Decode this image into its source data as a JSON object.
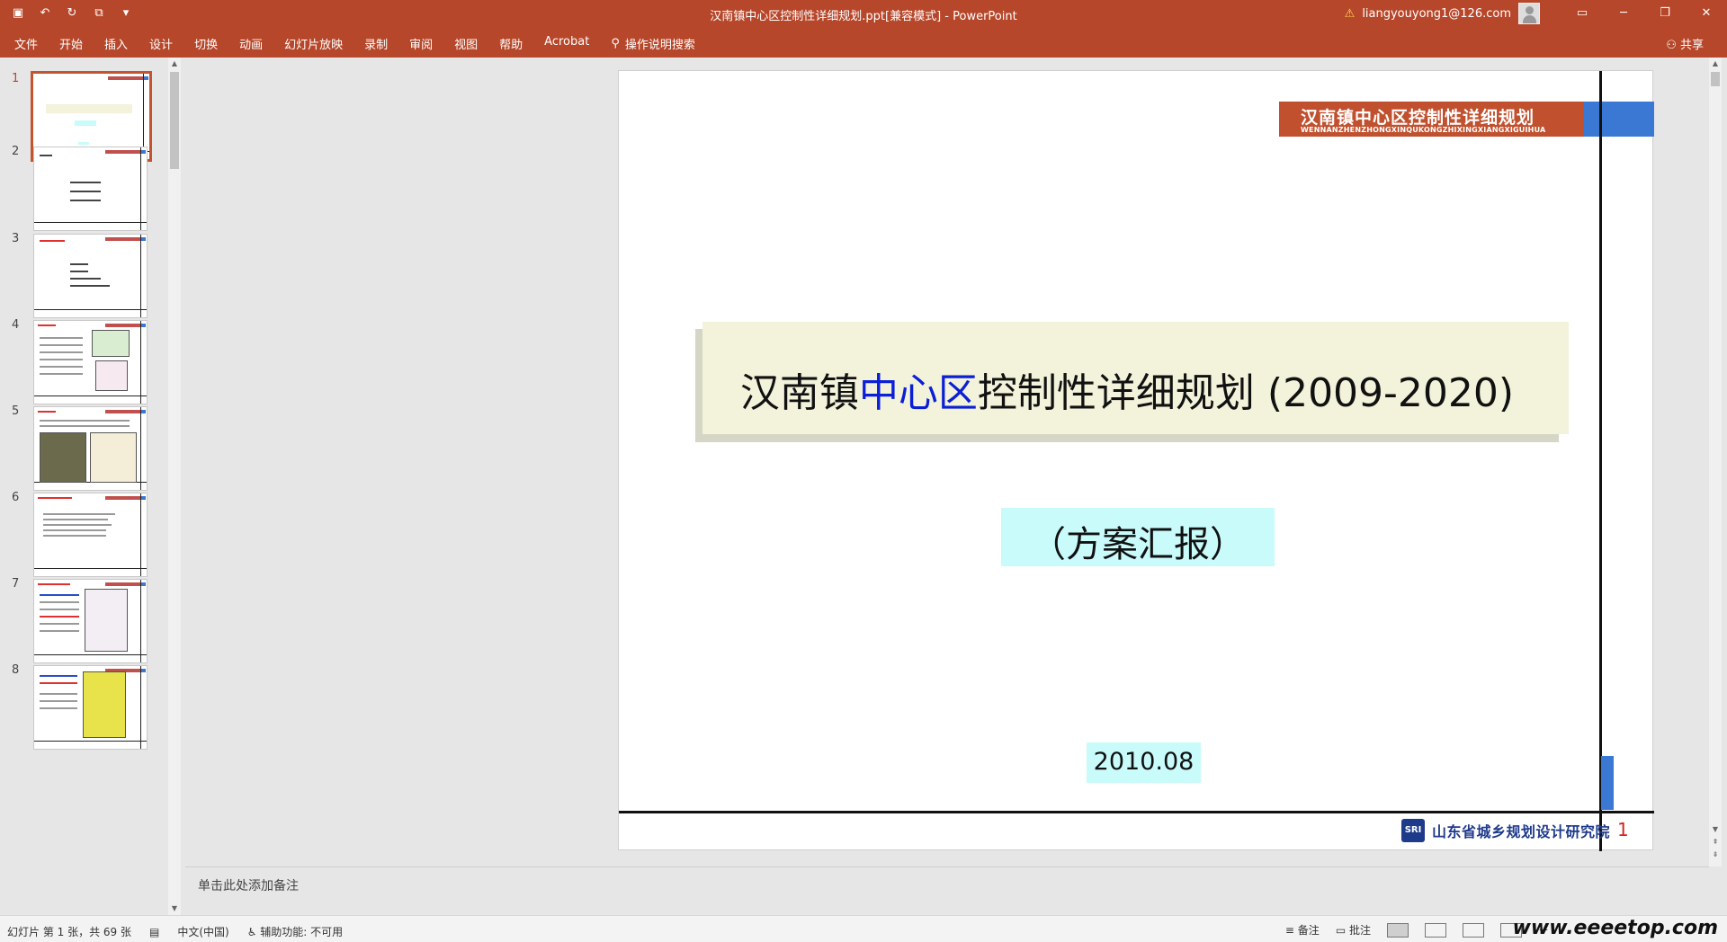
{
  "window": {
    "title": "汉南镇中心区控制性详细规划.ppt[兼容模式]  -  PowerPoint",
    "user_email": "liangyouyong1@126.com",
    "qa_icons": [
      "save-icon",
      "undo-icon",
      "redo-icon",
      "start-from-beginning-icon",
      "customize-icon"
    ],
    "controls": {
      "ribbon_display": "▭",
      "minimize": "─",
      "restore": "❐",
      "close": "✕"
    }
  },
  "ribbon": {
    "tabs": [
      "文件",
      "开始",
      "插入",
      "设计",
      "切换",
      "动画",
      "幻灯片放映",
      "录制",
      "审阅",
      "视图",
      "帮助",
      "Acrobat"
    ],
    "tell_me": "操作说明搜索",
    "share": "共享"
  },
  "thumbnails": [
    "1",
    "2",
    "3",
    "4",
    "5",
    "6",
    "7",
    "8"
  ],
  "slide": {
    "banner_cn": "汉南镇中心区控制性详细规划",
    "banner_en": "WENNANZHENZHONGXINQUKONGZHIXINGXIANGXIGUIHUA",
    "title_pre": "汉南镇",
    "title_hl": "中心区",
    "title_post": "控制性详细规划 (2009-2020)",
    "subtitle": "（方案汇报）",
    "date": "2010.08",
    "footer_org": "山东省城乡规划设计研究院",
    "footer_logo": "SRI",
    "page_number": "1"
  },
  "notes": {
    "placeholder": "单击此处添加备注"
  },
  "status": {
    "slide_info": "幻灯片 第 1 张，共 69 张",
    "language": "中文(中国)",
    "accessibility": "辅助功能: 不可用",
    "notes_btn": "备注",
    "comments_btn": "批注",
    "zoom_minus": "－",
    "watermark": "www.eeeetop.com"
  },
  "colors": {
    "accent": "#b7472a",
    "title_highlight": "#0a1fd8",
    "banner": "#c0502e",
    "banner_blue": "#3a78d4"
  }
}
